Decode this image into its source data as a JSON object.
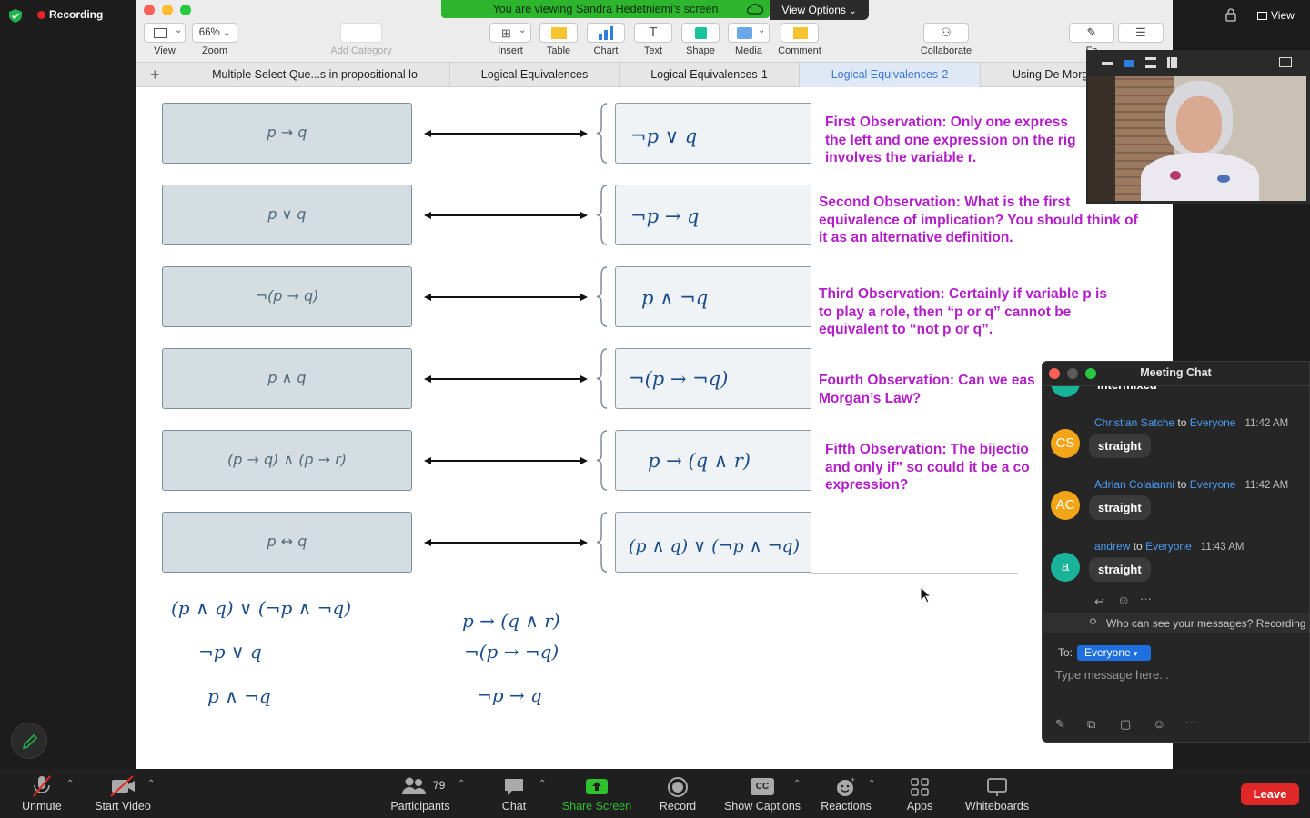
{
  "recording": {
    "label": "Recording"
  },
  "top_right": {
    "view_label": "View"
  },
  "share_banner": {
    "text": "You are viewing Sandra Hedetniemi's screen",
    "view_options": "View Options"
  },
  "toolbar": {
    "view_label": "View",
    "zoom_value": "66%",
    "zoom_label": "Zoom",
    "add_category_label": "Add Category",
    "insert_label": "Insert",
    "table_label": "Table",
    "chart_label": "Chart",
    "text_label": "Text",
    "shape_label": "Shape",
    "media_label": "Media",
    "comment_label": "Comment",
    "collaborate_label": "Collaborate",
    "format_label": "Fo"
  },
  "tabs": [
    {
      "label": "Multiple Select Que...s in propositional lo"
    },
    {
      "label": "Logical Equivalences"
    },
    {
      "label": "Logical Equivalences-1"
    },
    {
      "label": "Logical Equivalences-2"
    },
    {
      "label": "Using De Morg"
    }
  ],
  "slide": {
    "rows": [
      {
        "left": "p → q",
        "right": "¬p ∨ q"
      },
      {
        "left": "p ∨ q",
        "right": "¬p → q"
      },
      {
        "left": "¬(p → q)",
        "right": "p ∧ ¬q"
      },
      {
        "left": "p ∧ q",
        "right": "¬(p → ¬q)"
      },
      {
        "left": "(p → q) ∧ (p → r)",
        "right": "p → (q ∧ r)"
      },
      {
        "left": "p ↔ q",
        "right": "(p ∧ q) ∨ (¬p ∧ ¬q)"
      }
    ],
    "observations": [
      {
        "lines": [
          "First Observation:  Only one express",
          "the left and one expression on the rig",
          "involves the variable r."
        ]
      },
      {
        "lines": [
          "Second Observation:  What is the first",
          "equivalence of implication? You should think of",
          "it as an alternative definition."
        ]
      },
      {
        "lines": [
          "Third Observation: Certainly if variable p is",
          "to play a role, then “p or q” cannot be",
          "equivalent to “not p or q”."
        ]
      },
      {
        "lines": [
          "Fourth Observation: Can we eas",
          "Morgan’s Law?"
        ]
      },
      {
        "lines": [
          "Fifth Observation:  The bijectio",
          "and only if” so could it be a co",
          "expression?"
        ]
      }
    ],
    "bottom_left": [
      "(p ∧ q) ∨ (¬p ∧ ¬q)",
      "¬p ∨ q",
      "p ∧ ¬q"
    ],
    "bottom_right": [
      "p → (q ∧ r)",
      "¬(p → ¬q)",
      "¬p → q"
    ]
  },
  "chat": {
    "title": "Meeting Chat",
    "partial_text": "intermixed",
    "messages": [
      {
        "initials": "CS",
        "color": "#f2a516",
        "name": "Christian Satche",
        "to_word": "to",
        "to": "Everyone",
        "time": "11:42 AM",
        "text": "straight"
      },
      {
        "initials": "AC",
        "color": "#f2a516",
        "name": "Adrian Colaianni",
        "to_word": "to",
        "to": "Everyone",
        "time": "11:42 AM",
        "text": "straight"
      },
      {
        "initials": "a",
        "color": "#19b39a",
        "name": "andrew",
        "to_word": "to",
        "to": "Everyone",
        "time": "11:43 AM",
        "text": "straight"
      }
    ],
    "who_can_see": "Who can see your messages? Recording",
    "to_label": "To:",
    "to_value": "Everyone",
    "input_placeholder": "Type message here..."
  },
  "bottom_bar": {
    "unmute": "Unmute",
    "start_video": "Start Video",
    "participants": "Participants",
    "participants_count": "79",
    "chat": "Chat",
    "share_screen": "Share Screen",
    "record": "Record",
    "show_captions": "Show Captions",
    "reactions": "Reactions",
    "apps": "Apps",
    "whiteboards": "Whiteboards",
    "leave": "Leave"
  },
  "colors": {
    "observation_purple": "#b21fc8",
    "math_blue": "#1b4d8a",
    "share_green": "#2db52d",
    "leave_red": "#e02828",
    "chat_name_blue": "#4a9df5"
  }
}
